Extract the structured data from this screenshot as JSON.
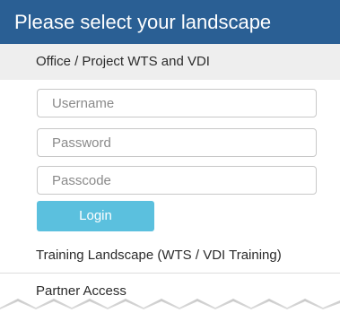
{
  "header": {
    "title": "Please select your landscape"
  },
  "landscapes": {
    "office": {
      "label": "Office / Project WTS and VDI",
      "form": {
        "username_placeholder": "Username",
        "password_placeholder": "Password",
        "passcode_placeholder": "Passcode",
        "login_label": "Login"
      }
    },
    "training": {
      "label": "Training Landscape (WTS / VDI Training)"
    },
    "partner": {
      "label": "Partner Access"
    }
  },
  "colors": {
    "header_bg": "#2a5f94",
    "active_section_bg": "#eeeeee",
    "login_button": "#5bc0de"
  }
}
